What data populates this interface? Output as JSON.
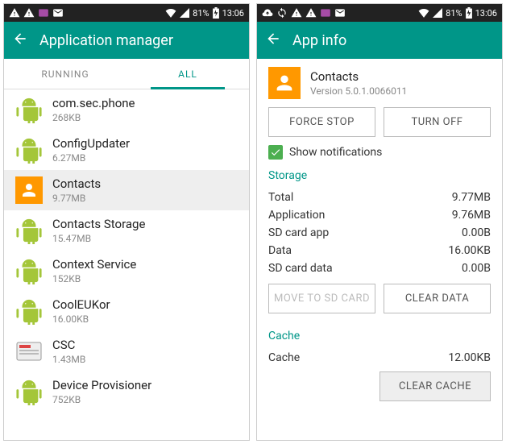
{
  "status": {
    "battery": "81%",
    "time": "13:06",
    "icons_left_a": [
      "warning-triangle-icon",
      "warning-triangle-icon",
      "nfc-icon",
      "mail-icon"
    ],
    "icons_left_b": [
      "cloud-upload-icon",
      "loop-icon",
      "warning-triangle-icon",
      "warning-triangle-icon",
      "nfc-icon",
      "mail-icon"
    ],
    "icons_right": [
      "wifi-icon",
      "signal-icon"
    ]
  },
  "left": {
    "title": "Application manager",
    "tabs": {
      "running": "RUNNING",
      "all": "ALL"
    },
    "apps": [
      {
        "name": "com.sec.phone",
        "size": "268KB",
        "icon": "android",
        "selected": false
      },
      {
        "name": "ConfigUpdater",
        "size": "6.27MB",
        "icon": "android",
        "selected": false
      },
      {
        "name": "Contacts",
        "size": "9.77MB",
        "icon": "contacts",
        "selected": true
      },
      {
        "name": "Contacts Storage",
        "size": "15.47MB",
        "icon": "android",
        "selected": false
      },
      {
        "name": "Context Service",
        "size": "152KB",
        "icon": "android",
        "selected": false
      },
      {
        "name": "CoolEUKor",
        "size": "16.00KB",
        "icon": "android",
        "selected": false
      },
      {
        "name": "CSC",
        "size": "1.43MB",
        "icon": "csc",
        "selected": false
      },
      {
        "name": "Device Provisioner",
        "size": "752KB",
        "icon": "android",
        "selected": false
      }
    ]
  },
  "right": {
    "title": "App info",
    "app": {
      "name": "Contacts",
      "version": "Version 5.0.1.0066011"
    },
    "buttons": {
      "force_stop": "FORCE STOP",
      "turn_off": "TURN OFF",
      "move_sd": "MOVE TO SD CARD",
      "clear_data": "CLEAR DATA",
      "clear_cache": "CLEAR CACHE"
    },
    "show_notifications": "Show notifications",
    "sections": {
      "storage": "Storage",
      "cache": "Cache"
    },
    "storage": [
      {
        "k": "Total",
        "v": "9.77MB"
      },
      {
        "k": "Application",
        "v": "9.76MB"
      },
      {
        "k": "SD card app",
        "v": "0.00B"
      },
      {
        "k": "Data",
        "v": "16.00KB"
      },
      {
        "k": "SD card data",
        "v": "0.00B"
      }
    ],
    "cache": {
      "k": "Cache",
      "v": "12.00KB"
    }
  }
}
